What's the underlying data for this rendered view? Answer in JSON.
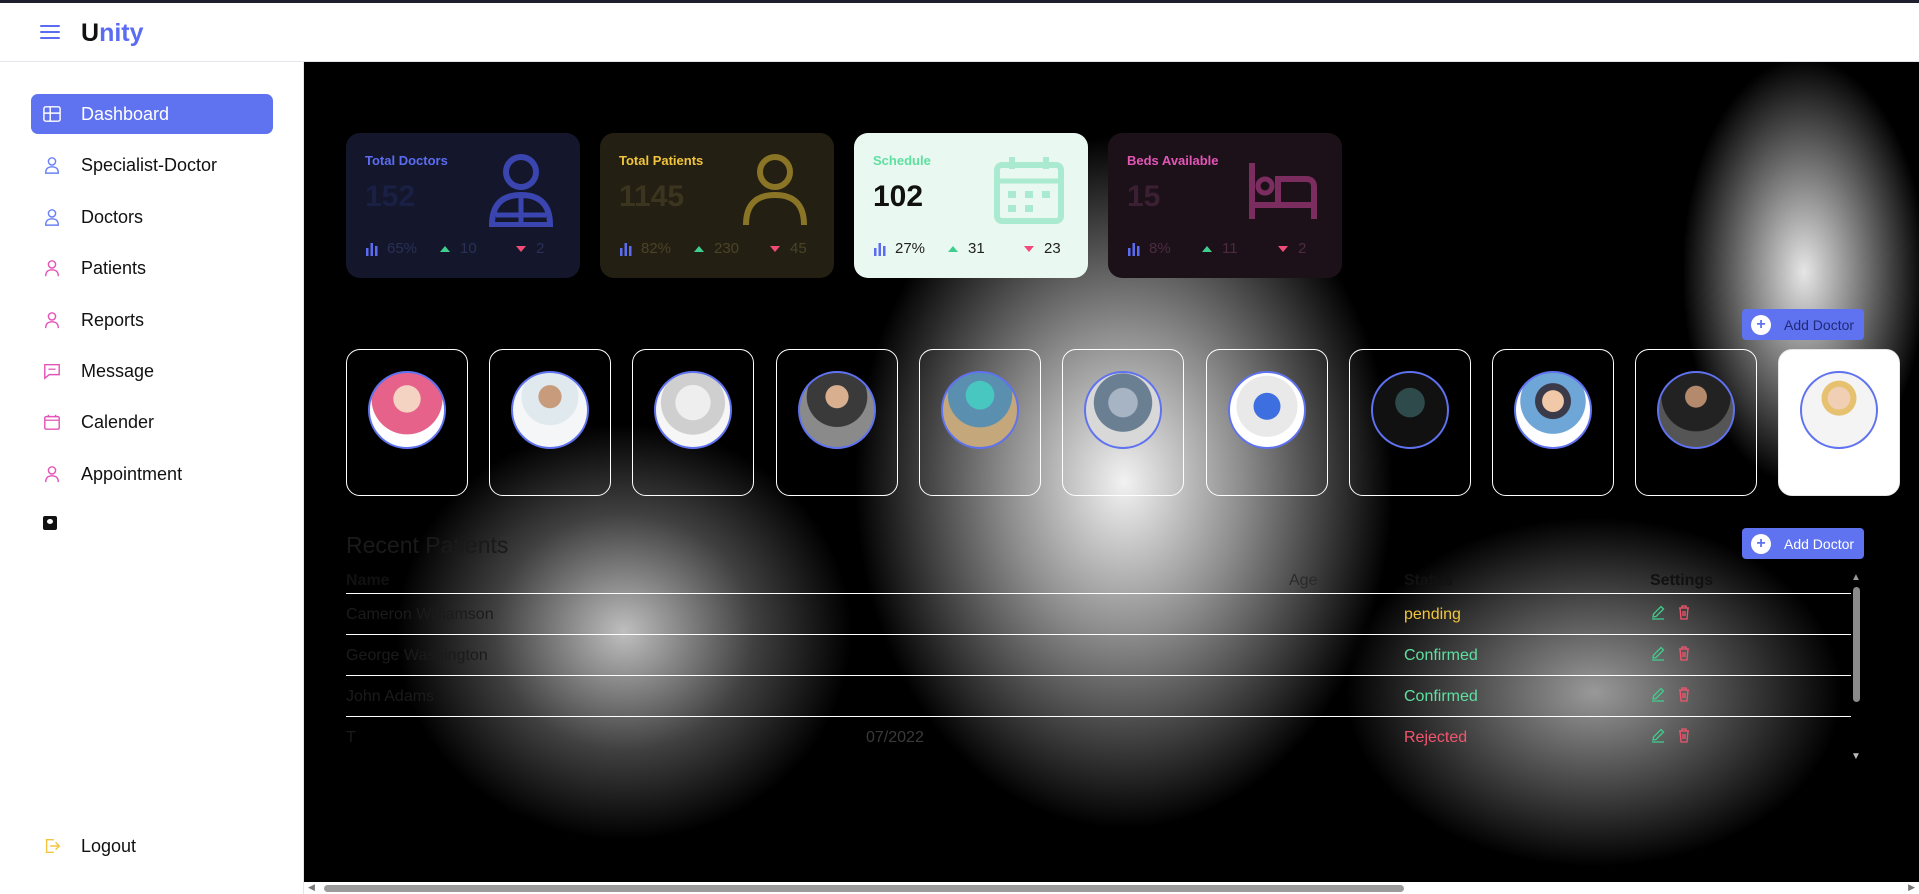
{
  "app": {
    "logo_first": "U",
    "logo_rest": "nity"
  },
  "sidebar": {
    "items": [
      {
        "label": "Dashboard",
        "icon": "grid-icon",
        "active": true
      },
      {
        "label": "Specialist-Doctor",
        "icon": "user-doctor-icon"
      },
      {
        "label": "Doctors",
        "icon": "user-doctor-icon"
      },
      {
        "label": "Patients",
        "icon": "user-icon"
      },
      {
        "label": "Reports",
        "icon": "user-icon"
      },
      {
        "label": "Message",
        "icon": "message-icon"
      },
      {
        "label": "Calender",
        "icon": "calendar-icon"
      },
      {
        "label": "Appointment",
        "icon": "user-icon"
      }
    ],
    "logout_label": "Logout"
  },
  "stats": [
    {
      "title": "Total Doctors",
      "value": "152",
      "percent": "65%",
      "up": "10",
      "down": "2",
      "color": "#5b6cf2"
    },
    {
      "title": "Total Patients",
      "value": "1145",
      "percent": "82%",
      "up": "230",
      "down": "45",
      "color": "#f2c53d"
    },
    {
      "title": "Schedule",
      "value": "102",
      "percent": "27%",
      "up": "31",
      "down": "23",
      "color": "#5ee0a0"
    },
    {
      "title": "Beds Available",
      "value": "15",
      "percent": "8%",
      "up": "11",
      "down": "2",
      "color": "#e455b8"
    }
  ],
  "add_doctor_label": "Add Doctor",
  "recent_patients": {
    "title": "Recent Patients",
    "columns": {
      "name": "Name",
      "age": "Age",
      "status": "Status",
      "settings": "Settings"
    },
    "rows": [
      {
        "name": "Cameron Williamson",
        "date": "",
        "status": "pending"
      },
      {
        "name": "George Washington",
        "date": "",
        "status": "Confirmed"
      },
      {
        "name": "John Adams",
        "date": "",
        "status": "Confirmed"
      },
      {
        "name": "T",
        "date": "07/2022",
        "status": "Rejected"
      }
    ]
  }
}
